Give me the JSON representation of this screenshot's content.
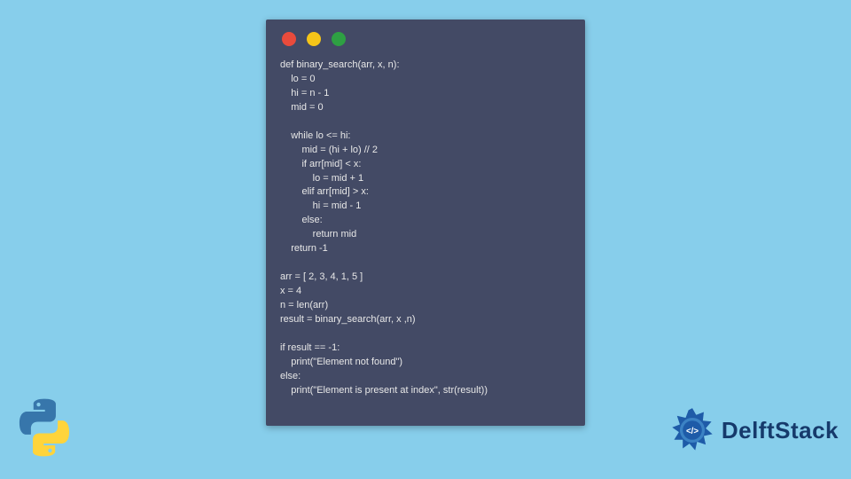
{
  "window": {
    "traffic_lights": [
      "red",
      "yellow",
      "green"
    ]
  },
  "code": {
    "lines": [
      "def binary_search(arr, x, n):",
      "    lo = 0",
      "    hi = n - 1",
      "    mid = 0",
      "",
      "    while lo <= hi:",
      "        mid = (hi + lo) // 2",
      "        if arr[mid] < x:",
      "            lo = mid + 1",
      "        elif arr[mid] > x:",
      "            hi = mid - 1",
      "        else:",
      "            return mid",
      "    return -1",
      "",
      "arr = [ 2, 3, 4, 1, 5 ]",
      "x = 4",
      "n = len(arr)",
      "result = binary_search(arr, x ,n)",
      "",
      "if result == -1:",
      "    print(\"Element not found\")",
      "else:",
      "    print(\"Element is present at index\", str(result))"
    ]
  },
  "brand": {
    "name": "DelftStack"
  },
  "colors": {
    "background": "#87CEEB",
    "window_bg": "#434A65",
    "code_fg": "#E8E8E8",
    "dot_red": "#E94B3C",
    "dot_yellow": "#F5C518",
    "dot_green": "#2EA043",
    "brand_text": "#163A6B",
    "python_blue": "#3776AB",
    "python_yellow": "#FFD43B"
  }
}
